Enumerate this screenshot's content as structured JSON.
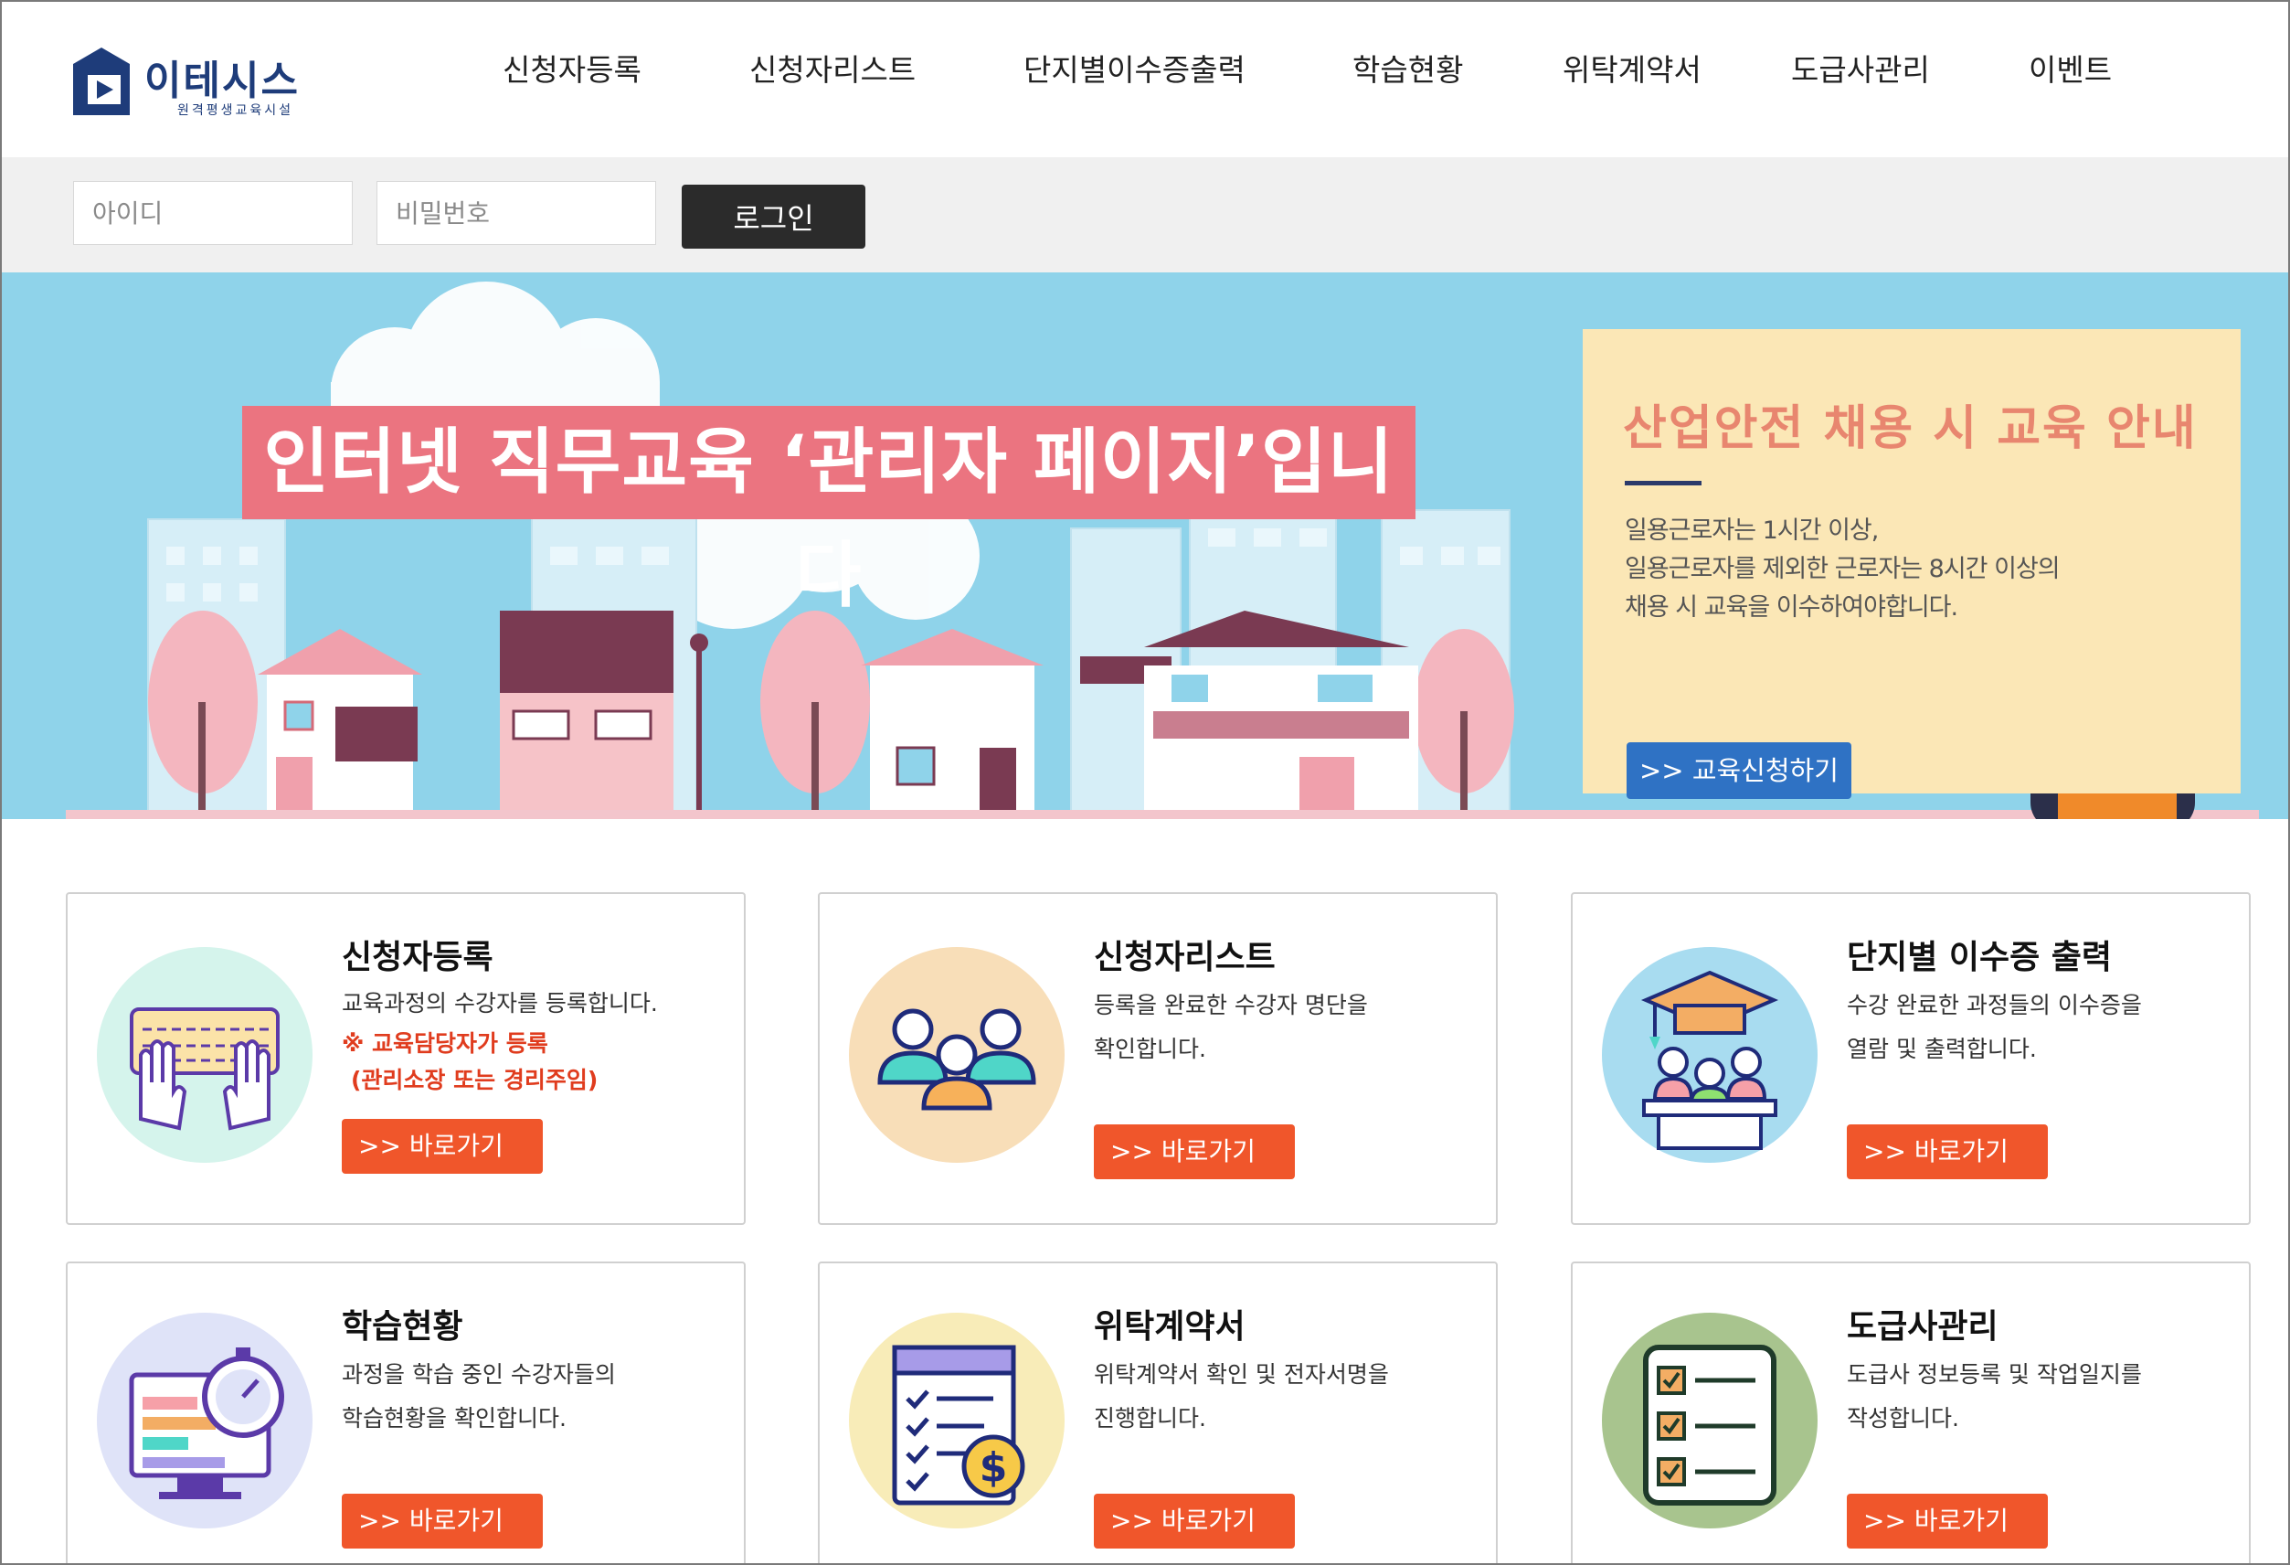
{
  "logo": {
    "name": "이테시스",
    "subtitle": "원격평생교육시설"
  },
  "nav": [
    {
      "label": "신청자등록"
    },
    {
      "label": "신청자리스트"
    },
    {
      "label": "단지별이수증출력"
    },
    {
      "label": "학습현황"
    },
    {
      "label": "위탁계약서"
    },
    {
      "label": "도급사관리"
    },
    {
      "label": "이벤트"
    }
  ],
  "login": {
    "id_placeholder": "아이디",
    "id_value": "",
    "pw_placeholder": "비밀번호",
    "pw_value": "",
    "button": "로그인"
  },
  "banner": {
    "title": "인터넷 직무교육 ‘관리자 페이지’입니다",
    "notice_title": "산업안전 채용 시 교육 안내",
    "notice_lines": [
      "일용근로자는 1시간 이상,",
      "일용근로자를 제외한 근로자는 8시간 이상의",
      "채용 시 교육을 이수하여야합니다."
    ],
    "notice_button": ">> 교육신청하기"
  },
  "cards": [
    {
      "title": "신청자등록",
      "desc": "교육과정의 수강자를 등록합니다.",
      "warn": "※ 교육담당자가 등록",
      "warn2": "(관리소장 또는 경리주임)",
      "button": ">> 바로가기",
      "icon": "keyboard-hands-icon"
    },
    {
      "title": "신청자리스트",
      "desc": "등록을 완료한 수강자 명단을",
      "desc2": "확인합니다.",
      "button": ">> 바로가기",
      "icon": "people-group-icon"
    },
    {
      "title": "단지별 이수증 출력",
      "desc": "수강 완료한 과정들의 이수증을",
      "desc2": "열람 및 출력합니다.",
      "button": ">> 바로가기",
      "icon": "graduation-class-icon"
    },
    {
      "title": "학습현황",
      "desc": "과정을 학습 중인 수강자들의",
      "desc2": "학습현황을 확인합니다.",
      "button": ">> 바로가기",
      "icon": "stopwatch-monitor-icon"
    },
    {
      "title": "위탁계약서",
      "desc": "위탁계약서 확인 및 전자서명을",
      "desc2": "진행합니다.",
      "button": ">> 바로가기",
      "icon": "contract-checklist-icon"
    },
    {
      "title": "도급사관리",
      "desc": "도급사 정보등록 및 작업일지를",
      "desc2": "작성합니다.",
      "button": ">> 바로가기",
      "icon": "checklist-board-icon"
    }
  ],
  "colors": {
    "accent_button": "#f0562b",
    "banner_sky": "#8fd3ea",
    "banner_title_bg": "#eb7480",
    "notice_bg": "#fbe7b6",
    "notice_button": "#2f72c4",
    "brand": "#1e3c7a"
  }
}
